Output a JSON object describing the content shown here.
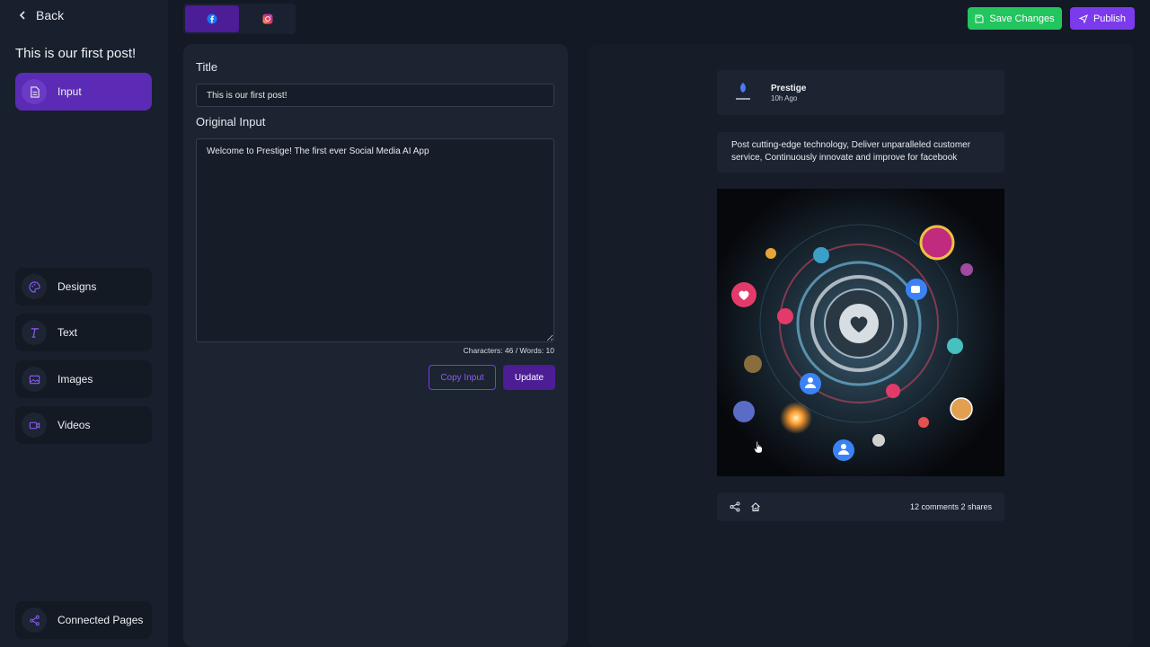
{
  "sidebar": {
    "back_label": "Back",
    "post_title": "This is our first post!",
    "items": [
      {
        "label": "Input",
        "icon": "document-icon"
      },
      {
        "label": "Designs",
        "icon": "palette-icon"
      },
      {
        "label": "Text",
        "icon": "text-icon"
      },
      {
        "label": "Images",
        "icon": "image-icon"
      },
      {
        "label": "Videos",
        "icon": "video-icon"
      }
    ],
    "connected_pages_label": "Connected Pages"
  },
  "platform_tabs": [
    {
      "name": "facebook",
      "icon": "facebook-icon",
      "active": true
    },
    {
      "name": "instagram",
      "icon": "instagram-icon",
      "active": false
    }
  ],
  "toolbar": {
    "save_label": "Save Changes",
    "publish_label": "Publish"
  },
  "editor": {
    "title_label": "Title",
    "title_value": "This is our first post!",
    "original_label": "Original Input",
    "original_value": "Welcome to Prestige! The first ever Social Media AI App",
    "counter": "Characters: 46 / Words: 10",
    "copy_label": "Copy Input",
    "update_label": "Update"
  },
  "preview": {
    "author": "Prestige",
    "time": "10h Ago",
    "text": "Post cutting-edge technology, Deliver unparalleled customer service, Continuously innovate and improve for facebook",
    "stats": "12 comments 2 shares"
  },
  "colors": {
    "accent": "#7c3aed",
    "active_nav": "#5b2bb5",
    "save": "#22c55e",
    "background": "#131a26"
  }
}
